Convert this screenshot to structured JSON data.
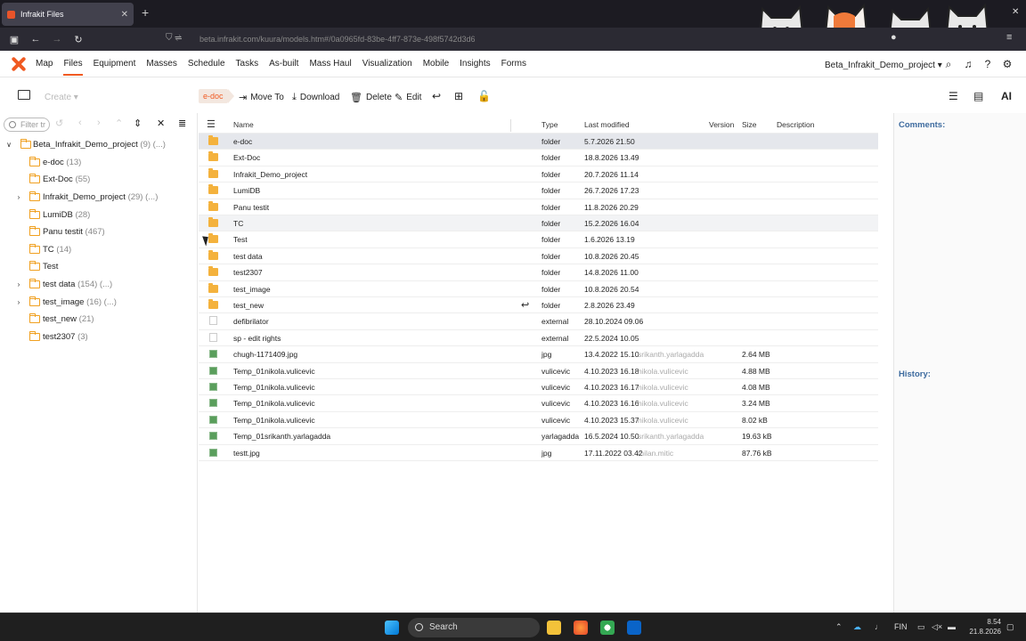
{
  "browser": {
    "tab_title": "Infrakit Files",
    "url": "beta.infrakit.com/kuura/models.htm#/0a0965fd-83be-4ff7-873e-498f5742d3d6"
  },
  "nav": {
    "items": [
      "Map",
      "Files",
      "Equipment",
      "Masses",
      "Schedule",
      "Tasks",
      "As-built",
      "Mass Haul",
      "Visualization",
      "Mobile",
      "Insights",
      "Forms"
    ],
    "active": "Files",
    "project": "Beta_Infrakit_Demo_project ▾"
  },
  "toolbar": {
    "create": "Create ▾",
    "breadcrumb": "e-doc",
    "move_to": "Move To",
    "download": "Download",
    "delete": "Delete",
    "edit": "Edit",
    "ai": "AI"
  },
  "sidebar": {
    "filter_placeholder": "Filter tr",
    "root": {
      "name": "Beta_Infrakit_Demo_project",
      "count": "(9) (...)"
    },
    "items": [
      {
        "name": "e-doc",
        "count": "(13)"
      },
      {
        "name": "Ext-Doc",
        "count": "(55)"
      },
      {
        "name": "Infrakit_Demo_project",
        "count": "(29) (...)"
      },
      {
        "name": "LumiDB",
        "count": "(28)"
      },
      {
        "name": "Panu testit",
        "count": "(467)"
      },
      {
        "name": "TC",
        "count": "(14)"
      },
      {
        "name": "Test",
        "count": ""
      },
      {
        "name": "test data",
        "count": "(154) (...)"
      },
      {
        "name": "test_image",
        "count": "(16) (...)"
      },
      {
        "name": "test_new",
        "count": "(21)"
      },
      {
        "name": "test2307",
        "count": "(3)"
      }
    ]
  },
  "table": {
    "headers": {
      "name": "Name",
      "type": "Type",
      "modified": "Last modified",
      "version": "Version",
      "size": "Size",
      "description": "Description"
    },
    "rows": [
      {
        "name": "e-doc",
        "type": "folder",
        "modified": "5.7.2026 21.50",
        "by": "",
        "size": "",
        "icon": "folder"
      },
      {
        "name": "Ext-Doc",
        "type": "folder",
        "modified": "18.8.2026 13.49",
        "by": "",
        "size": "",
        "icon": "folder"
      },
      {
        "name": "Infrakit_Demo_project",
        "type": "folder",
        "modified": "20.7.2026 11.14",
        "by": "",
        "size": "",
        "icon": "folder"
      },
      {
        "name": "LumiDB",
        "type": "folder",
        "modified": "26.7.2026 17.23",
        "by": "",
        "size": "",
        "icon": "folder"
      },
      {
        "name": "Panu testit",
        "type": "folder",
        "modified": "11.8.2026 20.29",
        "by": "",
        "size": "",
        "icon": "folder"
      },
      {
        "name": "TC",
        "type": "folder",
        "modified": "15.2.2026 16.04",
        "by": "",
        "size": "",
        "icon": "folder"
      },
      {
        "name": "Test",
        "type": "folder",
        "modified": "1.6.2026 13.19",
        "by": "",
        "size": "",
        "icon": "folder"
      },
      {
        "name": "test data",
        "type": "folder",
        "modified": "10.8.2026 20.45",
        "by": "",
        "size": "",
        "icon": "folder"
      },
      {
        "name": "test2307",
        "type": "folder",
        "modified": "14.8.2026 11.00",
        "by": "",
        "size": "",
        "icon": "folder"
      },
      {
        "name": "test_image",
        "type": "folder",
        "modified": "10.8.2026 20.54",
        "by": "",
        "size": "",
        "icon": "folder"
      },
      {
        "name": "test_new",
        "type": "folder",
        "modified": "2.8.2026 23.49",
        "by": "",
        "size": "",
        "icon": "folder"
      },
      {
        "name": "defibrilator",
        "type": "external",
        "modified": "28.10.2024 09.06",
        "by": "",
        "size": "",
        "icon": "file"
      },
      {
        "name": "sp - edit rights",
        "type": "external",
        "modified": "22.5.2024 10.05",
        "by": "",
        "size": "",
        "icon": "file"
      },
      {
        "name": "chugh-1171409.jpg",
        "type": "jpg",
        "modified": "13.4.2022 15.10",
        "by": "srikanth.yarlagadda",
        "size": "2.64 MB",
        "icon": "img"
      },
      {
        "name": "Temp_01nikola.vulicevic",
        "type": "vulicevic",
        "modified": "4.10.2023 16.18",
        "by": "nikola.vulicevic",
        "size": "4.88 MB",
        "icon": "img"
      },
      {
        "name": "Temp_01nikola.vulicevic",
        "type": "vulicevic",
        "modified": "4.10.2023 16.17",
        "by": "nikola.vulicevic",
        "size": "4.08 MB",
        "icon": "img"
      },
      {
        "name": "Temp_01nikola.vulicevic",
        "type": "vulicevic",
        "modified": "4.10.2023 16.16",
        "by": "nikola.vulicevic",
        "size": "3.24 MB",
        "icon": "img"
      },
      {
        "name": "Temp_01nikola.vulicevic",
        "type": "vulicevic",
        "modified": "4.10.2023 15.37",
        "by": "nikola.vulicevic",
        "size": "8.02 kB",
        "icon": "img"
      },
      {
        "name": "Temp_01srikanth.yarlagadda",
        "type": "yarlagadda",
        "modified": "16.5.2024 10.50",
        "by": "srikanth.yarlagadda",
        "size": "19.63 kB",
        "icon": "img"
      },
      {
        "name": "testt.jpg",
        "type": "jpg",
        "modified": "17.11.2022 03.42",
        "by": "milan.mitic",
        "size": "87.76 kB",
        "icon": "img"
      }
    ]
  },
  "right_panel": {
    "comments": "Comments:",
    "history": "History:"
  },
  "taskbar": {
    "search": "Search",
    "lang": "FIN",
    "time": "8.54",
    "date": "21.8.2026"
  }
}
